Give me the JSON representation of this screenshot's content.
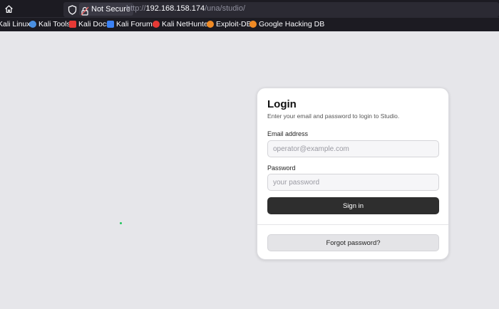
{
  "browser": {
    "security_label": "Not Secure",
    "url": {
      "protocol": "http://",
      "host": "192.168.158.174",
      "path": "/una/studio/"
    },
    "bookmarks": [
      {
        "label": "Kali Linux",
        "icon": "kali-icon",
        "color": "#2a7bde"
      },
      {
        "label": "Kali Tools",
        "icon": "kali-tools-icon",
        "color": "#4a90e2"
      },
      {
        "label": "Kali Docs",
        "icon": "kali-docs-icon",
        "color": "#e53935"
      },
      {
        "label": "Kali Forums",
        "icon": "kali-forums-icon",
        "color": "#3b82f6"
      },
      {
        "label": "Kali NetHunter",
        "icon": "nethunter-icon",
        "color": "#e53935"
      },
      {
        "label": "Exploit-DB",
        "icon": "exploit-db-icon",
        "color": "#f08a24"
      },
      {
        "label": "Google Hacking DB",
        "icon": "ghdb-icon",
        "color": "#f08a24"
      }
    ]
  },
  "login": {
    "title": "Login",
    "subtitle": "Enter your email and password to login to Studio.",
    "email_label": "Email address",
    "email_placeholder": "operator@example.com",
    "password_label": "Password",
    "password_placeholder": "your password",
    "signin_label": "Sign in",
    "forgot_label": "Forgot password?"
  },
  "colors": {
    "page_bg": "#e6e6ea",
    "primary_button": "#2e2e2e",
    "chrome_bg": "#1c1b22"
  }
}
